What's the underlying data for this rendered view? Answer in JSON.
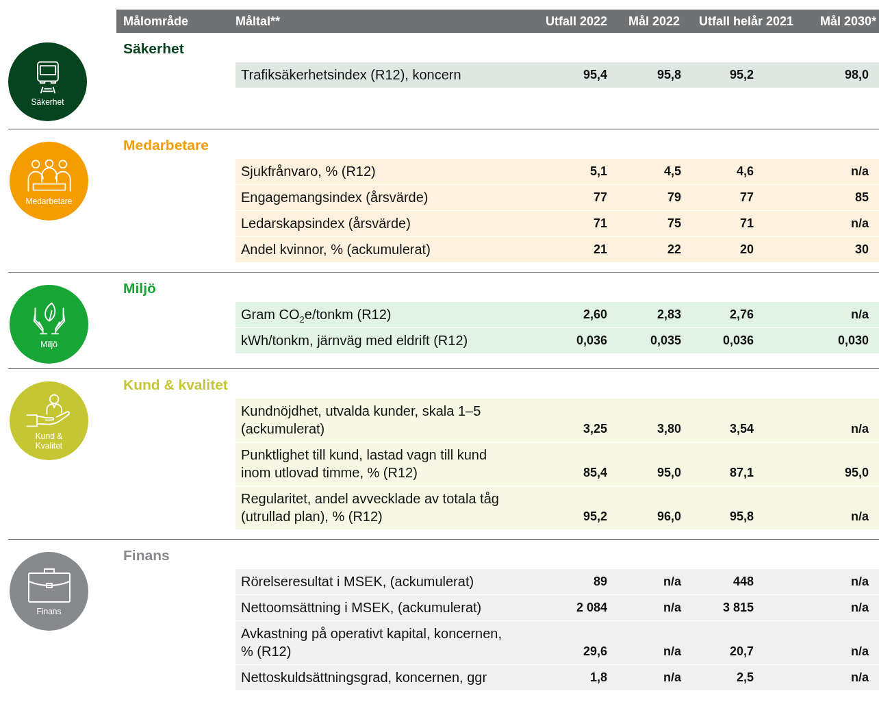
{
  "header": {
    "columns": [
      "Målområde",
      "Måltal**",
      "Utfall 2022",
      "Mål 2022",
      "Utfall helår 2021",
      "Mål 2030*"
    ]
  },
  "sections": [
    {
      "title": "Säkerhet",
      "badge_label": "Säkerhet",
      "color": "#064420",
      "rows": [
        {
          "label": "Trafiksäkerhetsindex (R12), koncern",
          "values": [
            "95,4",
            "95,8",
            "95,2",
            "98,0"
          ]
        }
      ]
    },
    {
      "title": "Medarbetare",
      "badge_label": "Medarbetare",
      "color": "#f59c00",
      "rows": [
        {
          "label": "Sjukfrånvaro, % (R12)",
          "values": [
            "5,1",
            "4,5",
            "4,6",
            "n/a"
          ]
        },
        {
          "label": "Engagemangsindex (årsvärde)",
          "values": [
            "77",
            "79",
            "77",
            "85"
          ]
        },
        {
          "label": "Ledarskapsindex (årsvärde)",
          "values": [
            "71",
            "75",
            "71",
            "n/a"
          ]
        },
        {
          "label": "Andel kvinnor, % (ackumulerat)",
          "values": [
            "21",
            "22",
            "20",
            "30"
          ]
        }
      ]
    },
    {
      "title": "Miljö",
      "badge_label": "Miljö",
      "color": "#17a536",
      "rows": [
        {
          "label": "Gram CO$_{2}$e/tonkm (R12)",
          "values": [
            "2,60",
            "2,83",
            "2,76",
            "n/a"
          ]
        },
        {
          "label": "kWh/tonkm, järnväg med eldrift (R12)",
          "values": [
            "0,036",
            "0,035",
            "0,036",
            "0,030"
          ]
        }
      ]
    },
    {
      "title": "Kund & kvalitet",
      "badge_label": "Kund & Kvalitet",
      "color": "#c5c632",
      "rows": [
        {
          "label": "Kundnöjdhet, utvalda kunder, skala 1–5 (ackumulerat)",
          "values": [
            "3,25",
            "3,80",
            "3,54",
            "n/a"
          ]
        },
        {
          "label": "Punktlighet till kund, lastad vagn till kund inom utlovad timme, % (R12)",
          "values": [
            "85,4",
            "95,0",
            "87,1",
            "95,0"
          ]
        },
        {
          "label": "Regularitet, andel avvecklade av totala tåg (utrullad plan), % (R12)",
          "values": [
            "95,2",
            "96,0",
            "95,8",
            "n/a"
          ]
        }
      ]
    },
    {
      "title": "Finans",
      "badge_label": "Finans",
      "color": "#88898d",
      "rows": [
        {
          "label": "Rörelseresultat i MSEK, (ackumulerat)",
          "values": [
            "89",
            "n/a",
            "448",
            "n/a"
          ]
        },
        {
          "label": "Nettoomsättning i MSEK, (ackumulerat)",
          "values": [
            "2 084",
            "n/a",
            "3 815",
            "n/a"
          ]
        },
        {
          "label": "Avkastning på operativt kapital, koncernen, % (R12)",
          "values": [
            "29,6",
            "n/a",
            "20,7",
            "n/a"
          ]
        },
        {
          "label": "Nettoskuldsättningsgrad, koncernen, ggr",
          "values": [
            "1,8",
            "n/a",
            "2,5",
            "n/a"
          ]
        }
      ]
    }
  ]
}
